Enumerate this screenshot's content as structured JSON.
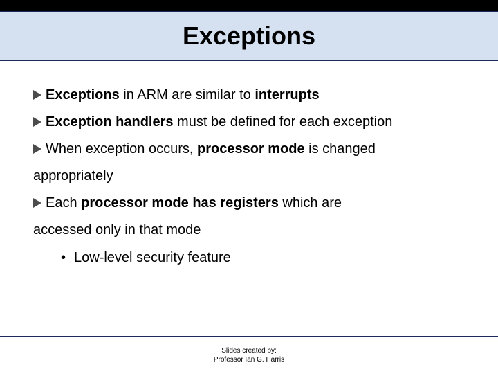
{
  "title": "Exceptions",
  "bullets": {
    "b1": {
      "t1": "Exceptions",
      "t2": " in ARM are similar to ",
      "t3": "interrupts"
    },
    "b2": {
      "t1": "Exception handlers",
      "t2": " must be defined for each exception"
    },
    "b3": {
      "t1": "When exception occurs, ",
      "t2": "processor mode",
      "t3": " is changed"
    },
    "b3cont": "appropriately",
    "b4": {
      "t1": "Each ",
      "t2": "processor mode has registers",
      "t3": " which are"
    },
    "b4cont": "accessed only in that mode",
    "sub1": "Low-level security feature"
  },
  "footer": {
    "line1": "Slides created by:",
    "line2": "Professor Ian G. Harris"
  }
}
